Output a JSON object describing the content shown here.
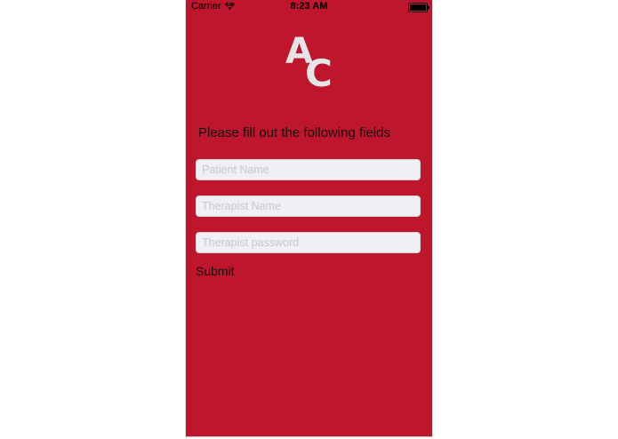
{
  "status_bar": {
    "carrier": "Carrier",
    "time": "8:23 AM",
    "wifi_icon": "wifi-icon",
    "battery_icon": "battery-full-icon"
  },
  "logo": {
    "letter_a": "A",
    "letter_c": "C"
  },
  "form": {
    "prompt": "Please fill out the following fields",
    "patient_name": {
      "value": "",
      "placeholder": "Patient Name"
    },
    "therapist_name": {
      "value": "",
      "placeholder": "Therapist Name"
    },
    "therapist_password": {
      "value": "",
      "placeholder": "Therapist password"
    },
    "submit_label": "Submit"
  },
  "colors": {
    "background": "#be162d",
    "field_bg": "#efeff4",
    "logo": "#e5e5e5"
  }
}
